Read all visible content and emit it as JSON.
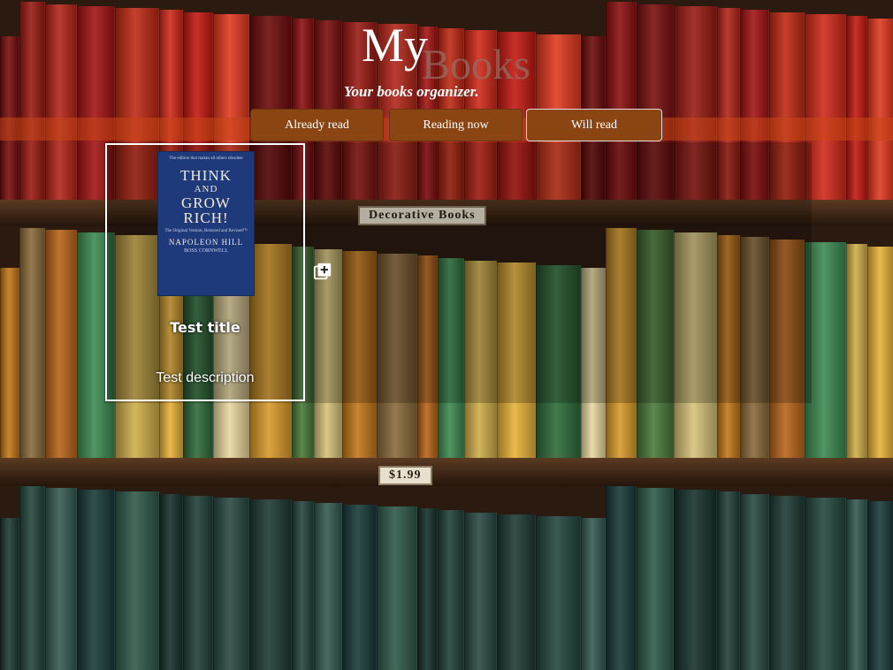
{
  "header": {
    "title_part1": "My",
    "title_part2": "Books",
    "subtitle": "Your books organizer."
  },
  "nav": {
    "already_read": "Already read",
    "reading_now": "Reading now",
    "will_read": "Will read"
  },
  "book_card": {
    "title": "Test title",
    "description": "Test description",
    "cover": {
      "tagline": "The edition that makes all others obsolete",
      "line1": "THINK",
      "line2": "AND",
      "line3": "GROW",
      "line4": "RICH!",
      "subtitle": "The Original Version, Restored and Revised™",
      "author": "NAPOLEON HILL",
      "editor": "BOSS CORNWELL"
    }
  },
  "shelf_labels": {
    "upper": "Decorative Books",
    "price": "$1.99"
  },
  "icons": {
    "add_to_list": "add-to-library-icon"
  },
  "colors": {
    "button_bg": "#8b4513",
    "nav_band": "#c84614",
    "text": "#ffffff"
  }
}
